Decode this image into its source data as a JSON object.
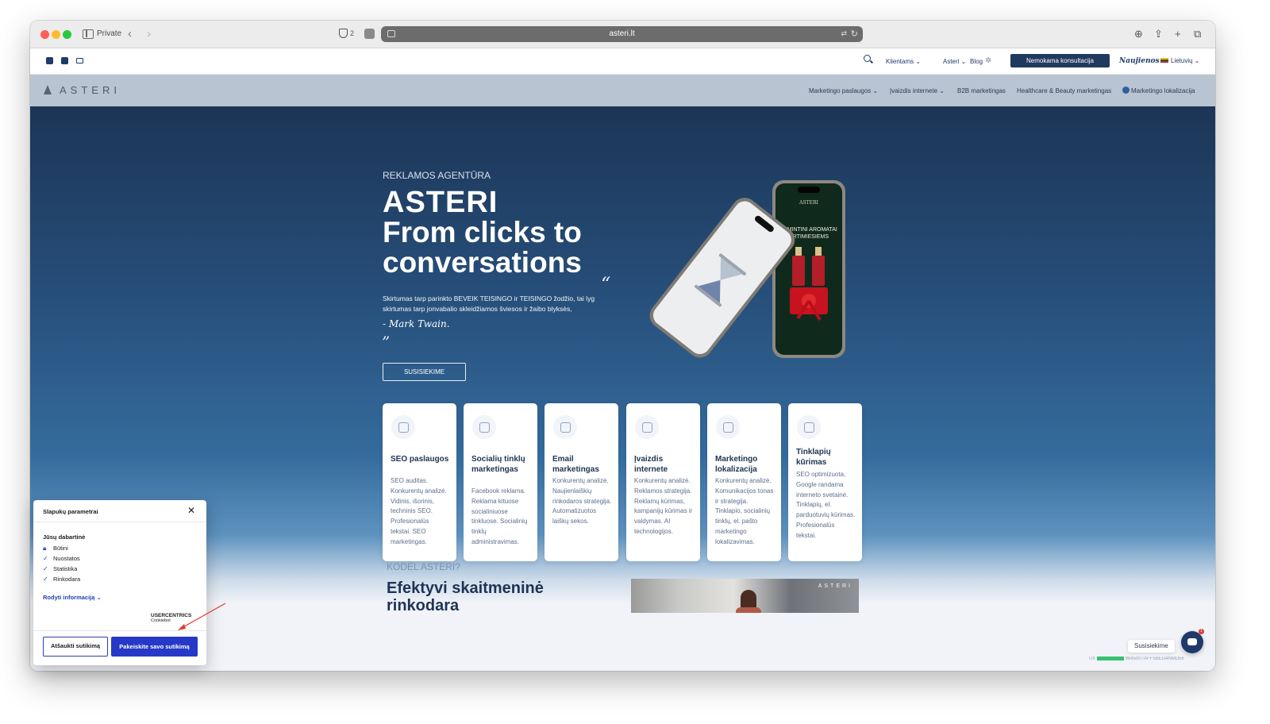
{
  "browser": {
    "private_label": "Private",
    "shield_count": "2",
    "url": "asteri.lt"
  },
  "topbar": {
    "links": [
      "Klientams ⌄",
      "Asteri ⌄",
      "Blog"
    ],
    "consult_button": "Nemokama konsultacija",
    "news": "Naujienos",
    "language": "Lietuvių ⌄"
  },
  "nav": {
    "logo": "ASTERI",
    "items": [
      "Marketingo paslaugos ⌄",
      "Įvaizdis internete ⌄",
      "B2B marketingas",
      "Healthcare & Beauty marketingas",
      "Marketingo lokalizacija"
    ]
  },
  "hero": {
    "eyebrow": "REKLAMOS AGENTŪRA",
    "title_lines": [
      "ASTERI",
      "From clicks to",
      "conversations"
    ],
    "quote_open": "“",
    "quote_text": "Skirtumas tarp parinkto BEVEIK TEISINGO ir TEISINGO žodžio, tai lyg skirtumas tarp jonvabalio skleidžiamos šviesos ir žaibo blyksės,",
    "quote_author": "- Mark Twain.",
    "quote_close": "”",
    "cta": "SUSISIEKIME",
    "phone_title_top": "ASTERI",
    "phone_promo": "ĮSIMINTINI AROMATAI ARTIMIESIEMS"
  },
  "services": [
    {
      "title": "SEO paslaugos",
      "desc": "SEO auditas. Konkurentų analizė. Vidinis, išorinis, techninis SEO. Profesionalūs tekstai. SEO marketingas.",
      "icon": "seo-icon"
    },
    {
      "title": "Socialių tinklų marketingas",
      "desc": "Facebook reklama. Reklama kituose socialiniuose tinkluose. Socialinių tinklų administravimas.",
      "icon": "social-media-icon"
    },
    {
      "title": "Email marketingas",
      "desc": "Konkurentų analizė. Naujienlaiškių rinkodaros strategija. Automatizuotos laiškų sekos.",
      "icon": "email-icon"
    },
    {
      "title": "Įvaizdis internete",
      "desc": "Konkurentų analizė. Reklamos strategija. Reklamų kūrimas, kampanijų kūrimas ir valdymas. AI technologijos.",
      "icon": "online-image-icon"
    },
    {
      "title": "Marketingo lokalizacija",
      "desc": "Konkurentų analizė. Komunikacijos tonas ir strategija. Tinklapio, socialinių tinklų, el. pašto marketingo lokalizavimas.",
      "icon": "localization-icon"
    },
    {
      "title": "Tinklapių kūrimas",
      "desc": "SEO optimizuota, Google randama interneto svetainė. Tinklapių, el. parduotuvių kūrimas. Profesionalūs tekstai.",
      "icon": "web-dev-icon"
    }
  ],
  "why": {
    "eyebrow": "KODĖL ASTERI?",
    "title": "Efektyvi skaitmeninė rinkodara",
    "image_logo": "ASTERI"
  },
  "chat": {
    "label": "Susisiekime",
    "badge": "1",
    "uid_prefix": "UII",
    "uid_code": "9845007AFF5BED4NMD56"
  },
  "cookie": {
    "title": "Slapukų parametrai",
    "subtitle": "Jūsų dabartinė",
    "items": [
      "Būtini",
      "Nuostatos",
      "Statistika",
      "Rinkodara"
    ],
    "more": "Rodyti informaciją",
    "brand": "USERCENTRICS",
    "brand_sub": "Cookiebot",
    "revoke": "Atšaukti sutikimą",
    "change": "Pakeiskite savo sutikimą"
  },
  "colors": {
    "navy": "#1f3a5f",
    "accent_blue": "#2638c7",
    "arrow_red": "#e23b2e"
  }
}
